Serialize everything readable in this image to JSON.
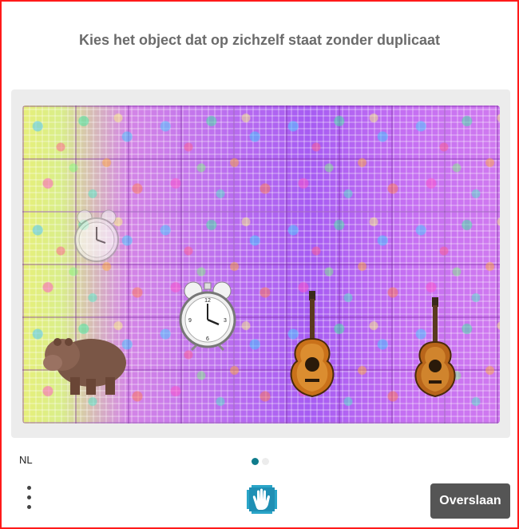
{
  "header": {
    "title": "Kies het object dat op zichzelf staat zonder duplicaat"
  },
  "puzzle": {
    "objects": [
      {
        "name": "alarm-clock",
        "faded": true
      },
      {
        "name": "alarm-clock",
        "faded": false
      },
      {
        "name": "hippo"
      },
      {
        "name": "acoustic-guitar"
      },
      {
        "name": "acoustic-guitar"
      }
    ]
  },
  "footer": {
    "language": "NL",
    "pagination": {
      "current": 1,
      "total": 2
    },
    "skip_label": "Overslaan",
    "menu_icon": "vertical-dots-icon",
    "logo_icon": "hand-logo-icon"
  },
  "colors": {
    "border": "#ff1a1a",
    "title": "#6b6b6b",
    "accent": "#0f7c8c",
    "skip_button": "#555555"
  }
}
